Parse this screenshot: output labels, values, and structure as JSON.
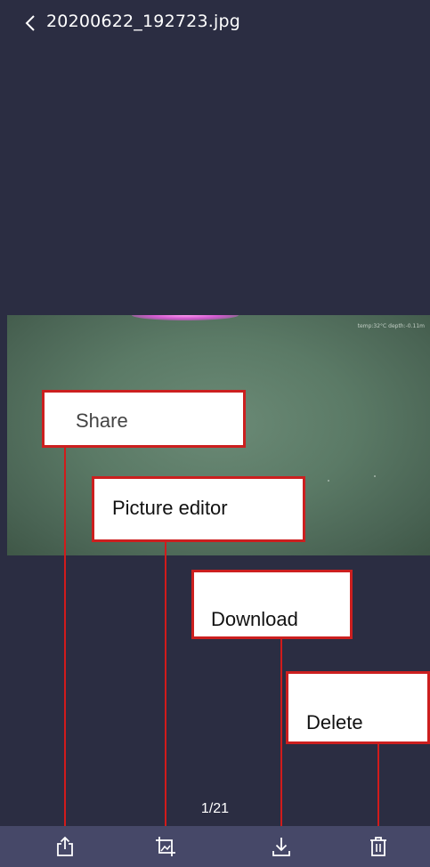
{
  "header": {
    "title": "20200622_192723.jpg",
    "back_icon": "chevron-left-icon"
  },
  "photo": {
    "overlay_text": "temp:32°C depth:-0.11m"
  },
  "pager": {
    "label": "1/21"
  },
  "toolbar": {
    "items": [
      {
        "icon": "share-icon"
      },
      {
        "icon": "picture-edit-icon"
      },
      {
        "icon": "download-icon"
      },
      {
        "icon": "delete-icon"
      }
    ]
  },
  "annotations": {
    "share": "Share",
    "picture_editor": "Picture editor",
    "download": "Download",
    "delete": "Delete"
  },
  "colors": {
    "background": "#2b2d42",
    "toolbar": "#464868",
    "callout_border": "#cc1f1f",
    "pointer_line": "#d11b1b"
  }
}
